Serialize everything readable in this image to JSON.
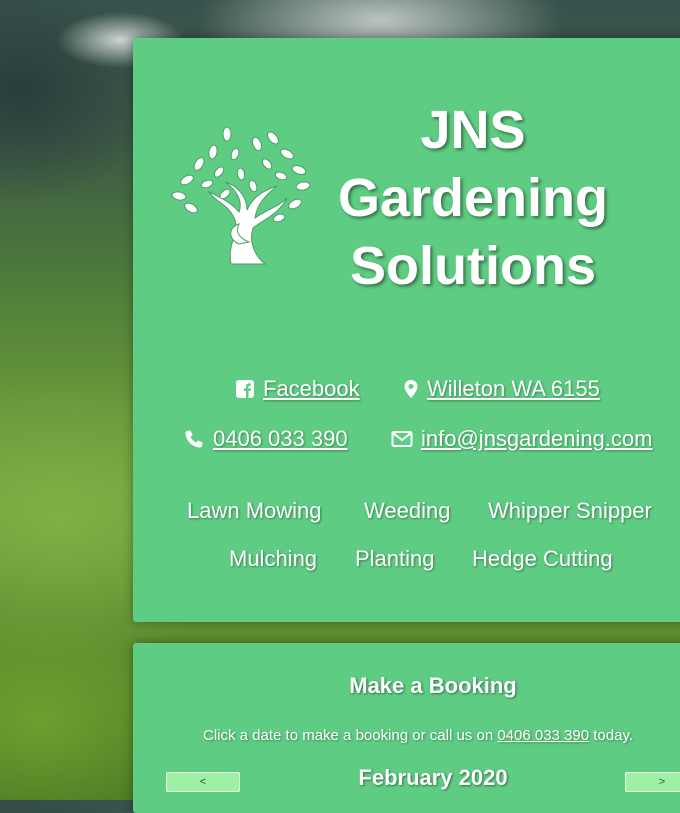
{
  "header": {
    "title_lines": [
      "JNS",
      "Gardening",
      "Solutions"
    ],
    "logo_icon": "tree-icon"
  },
  "contacts": {
    "facebook": {
      "label": "Facebook",
      "icon": "facebook-icon"
    },
    "location": {
      "label": "Willeton WA 6155",
      "icon": "map-pin-icon"
    },
    "phone": {
      "label": "0406 033 390",
      "icon": "phone-icon"
    },
    "email": {
      "label": "info@jnsgardening.com",
      "icon": "mail-icon"
    }
  },
  "services": [
    "Lawn Mowing",
    "Weeding",
    "Whipper Snipper",
    "Mulching",
    "Planting",
    "Hedge Cutting"
  ],
  "booking": {
    "title": "Make a Booking",
    "text_before": "Click a date to make a booking or call us on ",
    "phone": "0406 033 390",
    "text_after": " today.",
    "month": "February 2020",
    "prev_label": "<",
    "next_label": ">"
  },
  "colors": {
    "panel": "#5ecc82",
    "button": "#9ef1a4"
  }
}
